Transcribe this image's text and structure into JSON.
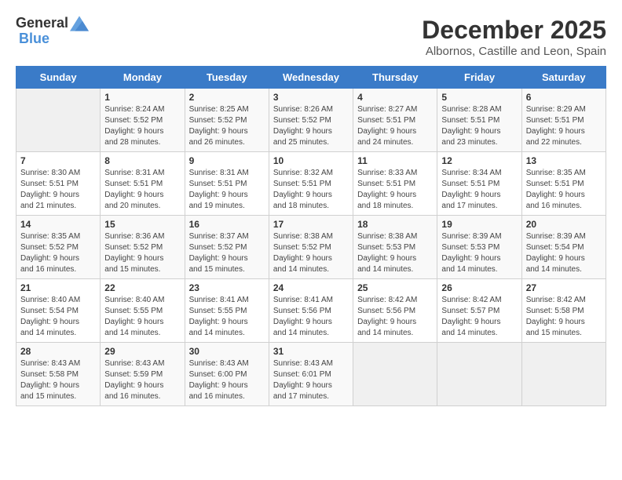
{
  "header": {
    "logo_general": "General",
    "logo_blue": "Blue",
    "month": "December 2025",
    "location": "Albornos, Castille and Leon, Spain"
  },
  "days_of_week": [
    "Sunday",
    "Monday",
    "Tuesday",
    "Wednesday",
    "Thursday",
    "Friday",
    "Saturday"
  ],
  "weeks": [
    {
      "cells": [
        {
          "day": "",
          "info": ""
        },
        {
          "day": "1",
          "info": "Sunrise: 8:24 AM\nSunset: 5:52 PM\nDaylight: 9 hours\nand 28 minutes."
        },
        {
          "day": "2",
          "info": "Sunrise: 8:25 AM\nSunset: 5:52 PM\nDaylight: 9 hours\nand 26 minutes."
        },
        {
          "day": "3",
          "info": "Sunrise: 8:26 AM\nSunset: 5:52 PM\nDaylight: 9 hours\nand 25 minutes."
        },
        {
          "day": "4",
          "info": "Sunrise: 8:27 AM\nSunset: 5:51 PM\nDaylight: 9 hours\nand 24 minutes."
        },
        {
          "day": "5",
          "info": "Sunrise: 8:28 AM\nSunset: 5:51 PM\nDaylight: 9 hours\nand 23 minutes."
        },
        {
          "day": "6",
          "info": "Sunrise: 8:29 AM\nSunset: 5:51 PM\nDaylight: 9 hours\nand 22 minutes."
        }
      ]
    },
    {
      "cells": [
        {
          "day": "7",
          "info": "Sunrise: 8:30 AM\nSunset: 5:51 PM\nDaylight: 9 hours\nand 21 minutes."
        },
        {
          "day": "8",
          "info": "Sunrise: 8:31 AM\nSunset: 5:51 PM\nDaylight: 9 hours\nand 20 minutes."
        },
        {
          "day": "9",
          "info": "Sunrise: 8:31 AM\nSunset: 5:51 PM\nDaylight: 9 hours\nand 19 minutes."
        },
        {
          "day": "10",
          "info": "Sunrise: 8:32 AM\nSunset: 5:51 PM\nDaylight: 9 hours\nand 18 minutes."
        },
        {
          "day": "11",
          "info": "Sunrise: 8:33 AM\nSunset: 5:51 PM\nDaylight: 9 hours\nand 18 minutes."
        },
        {
          "day": "12",
          "info": "Sunrise: 8:34 AM\nSunset: 5:51 PM\nDaylight: 9 hours\nand 17 minutes."
        },
        {
          "day": "13",
          "info": "Sunrise: 8:35 AM\nSunset: 5:51 PM\nDaylight: 9 hours\nand 16 minutes."
        }
      ]
    },
    {
      "cells": [
        {
          "day": "14",
          "info": "Sunrise: 8:35 AM\nSunset: 5:52 PM\nDaylight: 9 hours\nand 16 minutes."
        },
        {
          "day": "15",
          "info": "Sunrise: 8:36 AM\nSunset: 5:52 PM\nDaylight: 9 hours\nand 15 minutes."
        },
        {
          "day": "16",
          "info": "Sunrise: 8:37 AM\nSunset: 5:52 PM\nDaylight: 9 hours\nand 15 minutes."
        },
        {
          "day": "17",
          "info": "Sunrise: 8:38 AM\nSunset: 5:52 PM\nDaylight: 9 hours\nand 14 minutes."
        },
        {
          "day": "18",
          "info": "Sunrise: 8:38 AM\nSunset: 5:53 PM\nDaylight: 9 hours\nand 14 minutes."
        },
        {
          "day": "19",
          "info": "Sunrise: 8:39 AM\nSunset: 5:53 PM\nDaylight: 9 hours\nand 14 minutes."
        },
        {
          "day": "20",
          "info": "Sunrise: 8:39 AM\nSunset: 5:54 PM\nDaylight: 9 hours\nand 14 minutes."
        }
      ]
    },
    {
      "cells": [
        {
          "day": "21",
          "info": "Sunrise: 8:40 AM\nSunset: 5:54 PM\nDaylight: 9 hours\nand 14 minutes."
        },
        {
          "day": "22",
          "info": "Sunrise: 8:40 AM\nSunset: 5:55 PM\nDaylight: 9 hours\nand 14 minutes."
        },
        {
          "day": "23",
          "info": "Sunrise: 8:41 AM\nSunset: 5:55 PM\nDaylight: 9 hours\nand 14 minutes."
        },
        {
          "day": "24",
          "info": "Sunrise: 8:41 AM\nSunset: 5:56 PM\nDaylight: 9 hours\nand 14 minutes."
        },
        {
          "day": "25",
          "info": "Sunrise: 8:42 AM\nSunset: 5:56 PM\nDaylight: 9 hours\nand 14 minutes."
        },
        {
          "day": "26",
          "info": "Sunrise: 8:42 AM\nSunset: 5:57 PM\nDaylight: 9 hours\nand 14 minutes."
        },
        {
          "day": "27",
          "info": "Sunrise: 8:42 AM\nSunset: 5:58 PM\nDaylight: 9 hours\nand 15 minutes."
        }
      ]
    },
    {
      "cells": [
        {
          "day": "28",
          "info": "Sunrise: 8:43 AM\nSunset: 5:58 PM\nDaylight: 9 hours\nand 15 minutes."
        },
        {
          "day": "29",
          "info": "Sunrise: 8:43 AM\nSunset: 5:59 PM\nDaylight: 9 hours\nand 16 minutes."
        },
        {
          "day": "30",
          "info": "Sunrise: 8:43 AM\nSunset: 6:00 PM\nDaylight: 9 hours\nand 16 minutes."
        },
        {
          "day": "31",
          "info": "Sunrise: 8:43 AM\nSunset: 6:01 PM\nDaylight: 9 hours\nand 17 minutes."
        },
        {
          "day": "",
          "info": ""
        },
        {
          "day": "",
          "info": ""
        },
        {
          "day": "",
          "info": ""
        }
      ]
    }
  ]
}
